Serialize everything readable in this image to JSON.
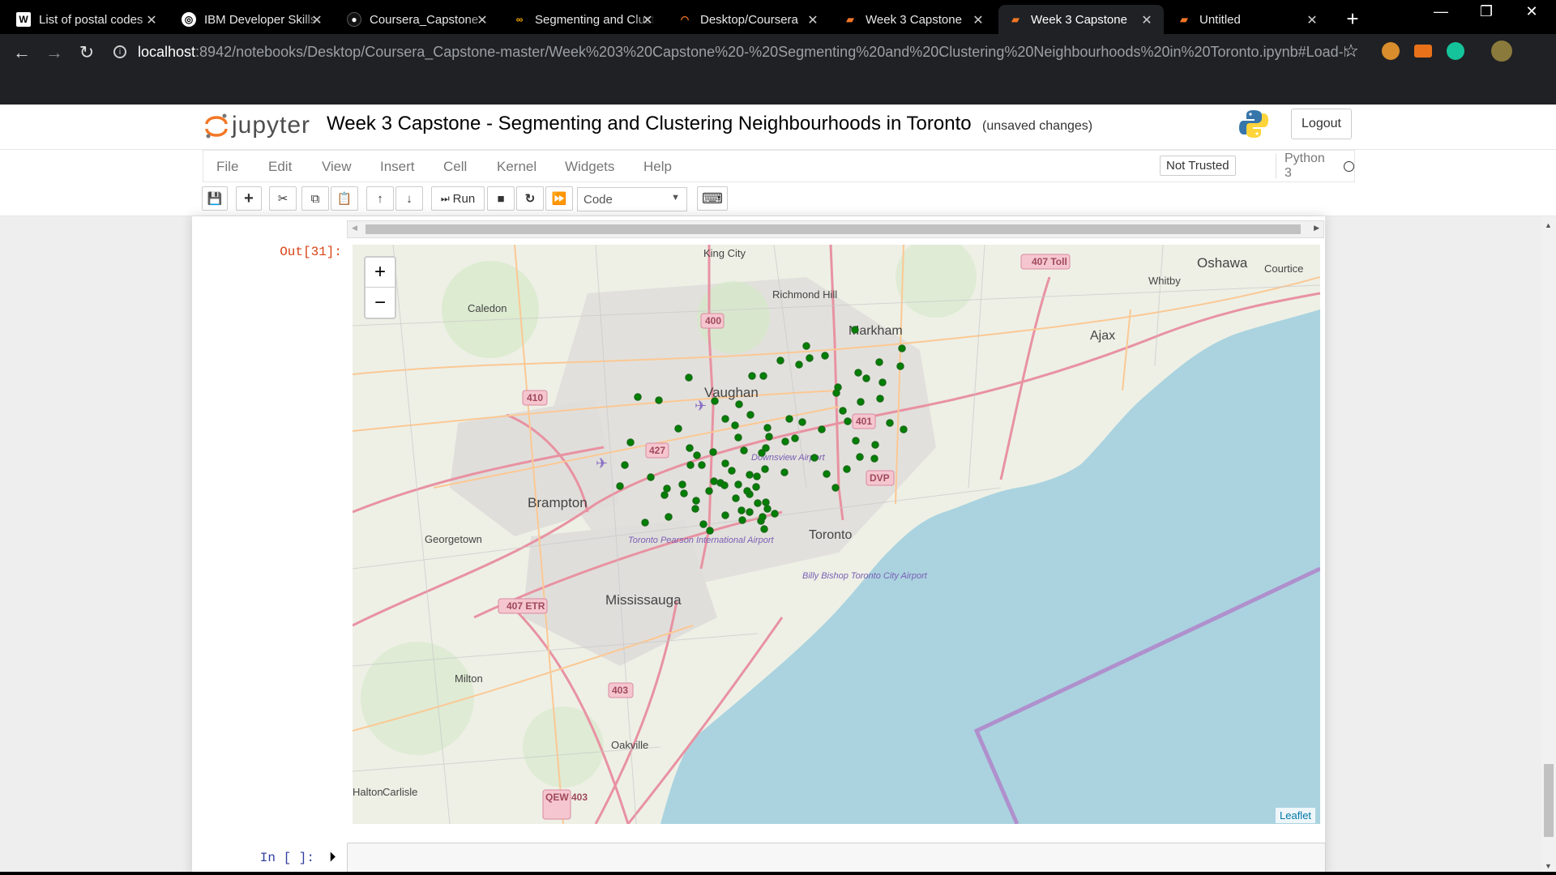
{
  "browser": {
    "tabs": [
      {
        "title": "List of postal codes",
        "favicon": "W"
      },
      {
        "title": "IBM Developer Skills",
        "favicon": "globe"
      },
      {
        "title": "Coursera_Capstone",
        "favicon": "github"
      },
      {
        "title": "Segmenting and Clustering",
        "favicon": "colab"
      },
      {
        "title": "Desktop/Coursera",
        "favicon": "jupyter"
      },
      {
        "title": "Week 3 Capstone",
        "favicon": "book"
      },
      {
        "title": "Week 3 Capstone",
        "favicon": "book"
      },
      {
        "title": "Untitled",
        "favicon": "book"
      }
    ],
    "active_tab": 6,
    "url_host": "localhost",
    "url_path": ":8942/notebooks/Desktop/Coursera_Capstone-master/Week%203%20Capstone%20-%20Segmenting%20and%20Clustering%20Neighbourhoods%20in%20Toronto.ipynb#Load-Li...",
    "close_glyph": "✕",
    "newtab_glyph": "+",
    "back_glyph": "←",
    "forward_glyph": "→",
    "reload_glyph": "↻",
    "info_glyph": "i",
    "star_glyph": "☆",
    "minimize_glyph": "—",
    "maximize_glyph": "❐",
    "window_close_glyph": "✕"
  },
  "jupyter": {
    "logo_text": "jupyter",
    "notebook_title": "Week 3 Capstone - Segmenting and Clustering Neighbourhoods in Toronto",
    "save_status": "(unsaved changes)",
    "logout_label": "Logout",
    "menu": [
      "File",
      "Edit",
      "View",
      "Insert",
      "Cell",
      "Kernel",
      "Widgets",
      "Help"
    ],
    "trust_label": "Not Trusted",
    "kernel_name": "Python 3",
    "toolbar": {
      "save_glyph": "💾",
      "add_glyph": "+",
      "cut_glyph": "✂",
      "copy_glyph": "⧉",
      "paste_glyph": "📋",
      "up_glyph": "↑",
      "down_glyph": "↓",
      "run_label": "Run",
      "run_glyph": "⏭",
      "stop_glyph": "■",
      "restart_glyph": "↻",
      "fastforward_glyph": "⏩",
      "cell_type": "Code",
      "cell_type_caret": "▼",
      "keyboard_glyph": "⌨"
    },
    "out_prompt": "Out[31]:",
    "in_prompt": "In [ ]:",
    "run_cell_glyph": "⏵"
  },
  "map": {
    "zoom_in": "+",
    "zoom_out": "−",
    "attribution": "Leaflet",
    "place_labels": [
      "King City",
      "Richmond Hill",
      "Markham",
      "Oshawa",
      "Courtice",
      "Whitby",
      "Ajax",
      "Caledon",
      "Vaughan",
      "Brampton",
      "Georgetown",
      "Mississauga",
      "Toronto",
      "Downsview Airport",
      "Toronto Pearson International Airport",
      "Billy Bishop Toronto City Airport",
      "Milton",
      "Oakville",
      "Carlisle",
      "Halton"
    ],
    "highway_labels": [
      "407 Toll",
      "400",
      "410",
      "427",
      "401",
      "DVP",
      "407 ETR",
      "403",
      "QEW 403"
    ],
    "marker_color": "#008000"
  }
}
